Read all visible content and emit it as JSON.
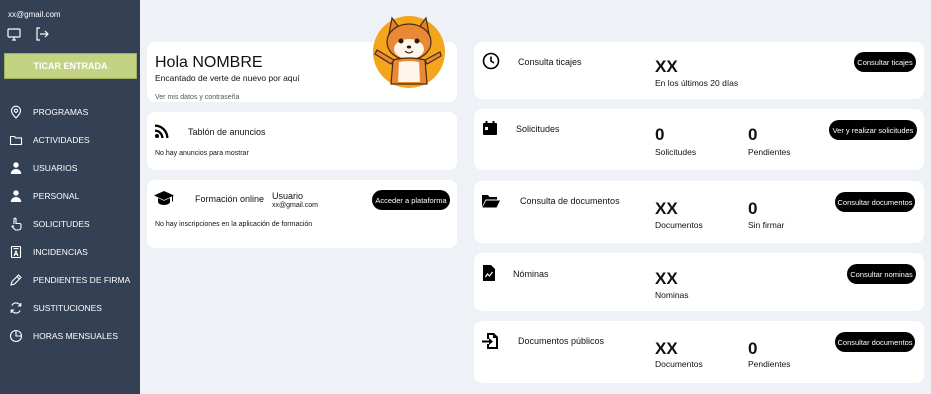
{
  "sidebar": {
    "email": "xx@gmail.com",
    "ticar_label": "TICAR ENTRADA",
    "items": [
      {
        "label": "PROGRAMAS"
      },
      {
        "label": "ACTIVIDADES"
      },
      {
        "label": "USUARIOS"
      },
      {
        "label": "PERSONAL"
      },
      {
        "label": "SOLICITUDES"
      },
      {
        "label": "INCIDENCIAS"
      },
      {
        "label": "PENDIENTES DE FIRMA"
      },
      {
        "label": "SUSTITUCIONES"
      },
      {
        "label": "HORAS MENSUALES"
      }
    ]
  },
  "welcome": {
    "title": "Hola NOMBRE",
    "subtitle": "Encantado de verte de nuevo por aquí",
    "link": "Ver mis datos y contraseña"
  },
  "announcements": {
    "title": "Tablón de anuncios",
    "empty": "No hay anuncios para mostrar"
  },
  "training": {
    "title": "Formación online",
    "user_label": "Usuario",
    "user_email": "xx@gmail.com",
    "button": "Acceder a plataforma",
    "empty": "No hay inscripciones en la aplicación de formación"
  },
  "clockings": {
    "title": "Consulta ticajes",
    "value": "XX",
    "caption": "En los últimos 20 días",
    "button": "Consultar ticajes"
  },
  "requests": {
    "title": "Solicitudes",
    "value1": "0",
    "label1": "Solicitudes",
    "value2": "0",
    "label2": "Pendientes",
    "button": "Ver y realizar solicitudes"
  },
  "documents": {
    "title": "Consulta de documentos",
    "value1": "XX",
    "label1": "Documentos",
    "value2": "0",
    "label2": "Sin firmar",
    "button": "Consultar documentos"
  },
  "payroll": {
    "title": "Nóminas",
    "value": "XX",
    "label": "Nominas",
    "button": "Consultar nominas"
  },
  "public_docs": {
    "title": "Documentos públicos",
    "value1": "XX",
    "label1": "Documentos",
    "value2": "0",
    "label2": "Pendientes",
    "button": "Consultar documentos"
  }
}
